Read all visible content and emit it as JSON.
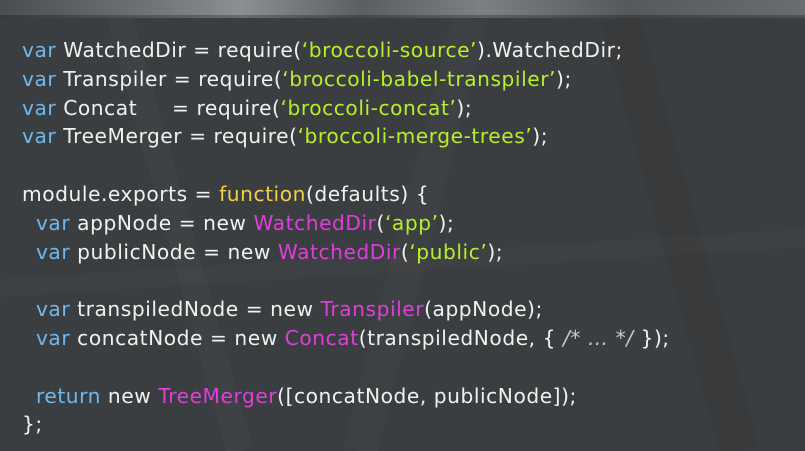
{
  "colors": {
    "background": "#3b3e40",
    "text": "#f1f1ee",
    "keyword": "#6fb8ee",
    "string": "#b7ef2b",
    "class": "#df3fd9",
    "function_keyword": "#f2cf4a"
  },
  "code_lines": [
    [
      {
        "type": "keyword",
        "text": "var"
      },
      {
        "type": "text",
        "text": " WatchedDir = require("
      },
      {
        "type": "string",
        "text": "‘broccoli-source’"
      },
      {
        "type": "text",
        "text": ").WatchedDir;"
      }
    ],
    [
      {
        "type": "keyword",
        "text": "var"
      },
      {
        "type": "text",
        "text": " Transpiler = require("
      },
      {
        "type": "string",
        "text": "‘broccoli-babel-transpiler’"
      },
      {
        "type": "text",
        "text": ");"
      }
    ],
    [
      {
        "type": "keyword",
        "text": "var"
      },
      {
        "type": "text",
        "text": " Concat     = require("
      },
      {
        "type": "string",
        "text": "‘broccoli-concat’"
      },
      {
        "type": "text",
        "text": ");"
      }
    ],
    [
      {
        "type": "keyword",
        "text": "var"
      },
      {
        "type": "text",
        "text": " TreeMerger = require("
      },
      {
        "type": "string",
        "text": "‘broccoli-merge-trees’"
      },
      {
        "type": "text",
        "text": ");"
      }
    ],
    [],
    [
      {
        "type": "text",
        "text": "module.exports = "
      },
      {
        "type": "function",
        "text": "function"
      },
      {
        "type": "text",
        "text": "(defaults) {"
      }
    ],
    [
      {
        "type": "text",
        "text": "  "
      },
      {
        "type": "keyword",
        "text": "var"
      },
      {
        "type": "text",
        "text": " appNode = new "
      },
      {
        "type": "class",
        "text": "WatchedDir"
      },
      {
        "type": "text",
        "text": "("
      },
      {
        "type": "string",
        "text": "‘app’"
      },
      {
        "type": "text",
        "text": ");"
      }
    ],
    [
      {
        "type": "text",
        "text": "  "
      },
      {
        "type": "keyword",
        "text": "var"
      },
      {
        "type": "text",
        "text": " publicNode = new "
      },
      {
        "type": "class",
        "text": "WatchedDir"
      },
      {
        "type": "text",
        "text": "("
      },
      {
        "type": "string",
        "text": "‘public’"
      },
      {
        "type": "text",
        "text": ");"
      }
    ],
    [],
    [
      {
        "type": "text",
        "text": "  "
      },
      {
        "type": "keyword",
        "text": "var"
      },
      {
        "type": "text",
        "text": " transpiledNode = new "
      },
      {
        "type": "class",
        "text": "Transpiler"
      },
      {
        "type": "text",
        "text": "(appNode);"
      }
    ],
    [
      {
        "type": "text",
        "text": "  "
      },
      {
        "type": "keyword",
        "text": "var"
      },
      {
        "type": "text",
        "text": " concatNode = new "
      },
      {
        "type": "class",
        "text": "Concat"
      },
      {
        "type": "text",
        "text": "(transpiledNode, { "
      },
      {
        "type": "comment",
        "text": "/* … */"
      },
      {
        "type": "text",
        "text": " });"
      }
    ],
    [],
    [
      {
        "type": "text",
        "text": "  "
      },
      {
        "type": "keyword",
        "text": "return"
      },
      {
        "type": "text",
        "text": " new "
      },
      {
        "type": "class",
        "text": "TreeMerger"
      },
      {
        "type": "text",
        "text": "([concatNode, publicNode]);"
      }
    ],
    [
      {
        "type": "text",
        "text": "};"
      }
    ]
  ]
}
